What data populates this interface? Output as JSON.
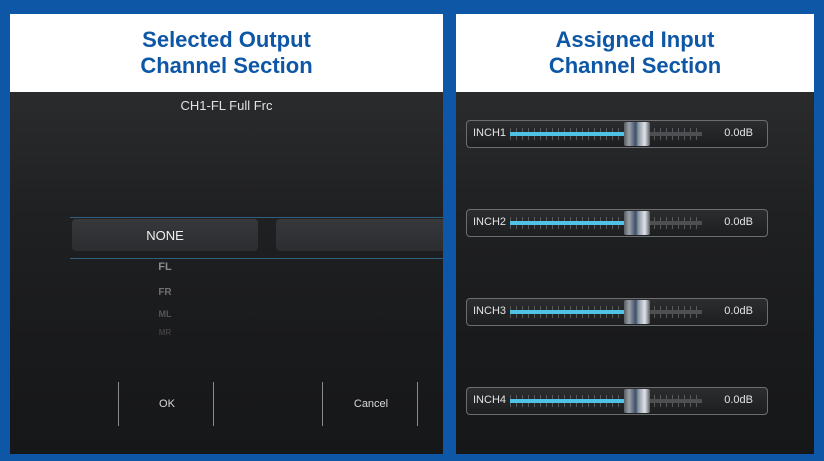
{
  "left_panel": {
    "header_line1": "Selected Output",
    "header_line2": "Channel Section",
    "dialog_title": "CH1-FL Full Frc",
    "picker": {
      "selected": "NONE",
      "options": [
        "FL",
        "FR",
        "ML",
        "MR"
      ]
    },
    "ok_label": "OK",
    "cancel_label": "Cancel"
  },
  "right_panel": {
    "header_line1": "Assigned Input",
    "header_line2": "Channel Section",
    "channels": [
      {
        "label": "INCH1",
        "value": "0.0dB",
        "level": 0.66
      },
      {
        "label": "INCH2",
        "value": "0.0dB",
        "level": 0.66
      },
      {
        "label": "INCH3",
        "value": "0.0dB",
        "level": 0.66
      },
      {
        "label": "INCH4",
        "value": "0.0dB",
        "level": 0.66
      }
    ]
  },
  "colors": {
    "frame_blue": "#0d57a6",
    "header_text": "#0d57a6",
    "fader_fill": "#4fc3e6"
  }
}
